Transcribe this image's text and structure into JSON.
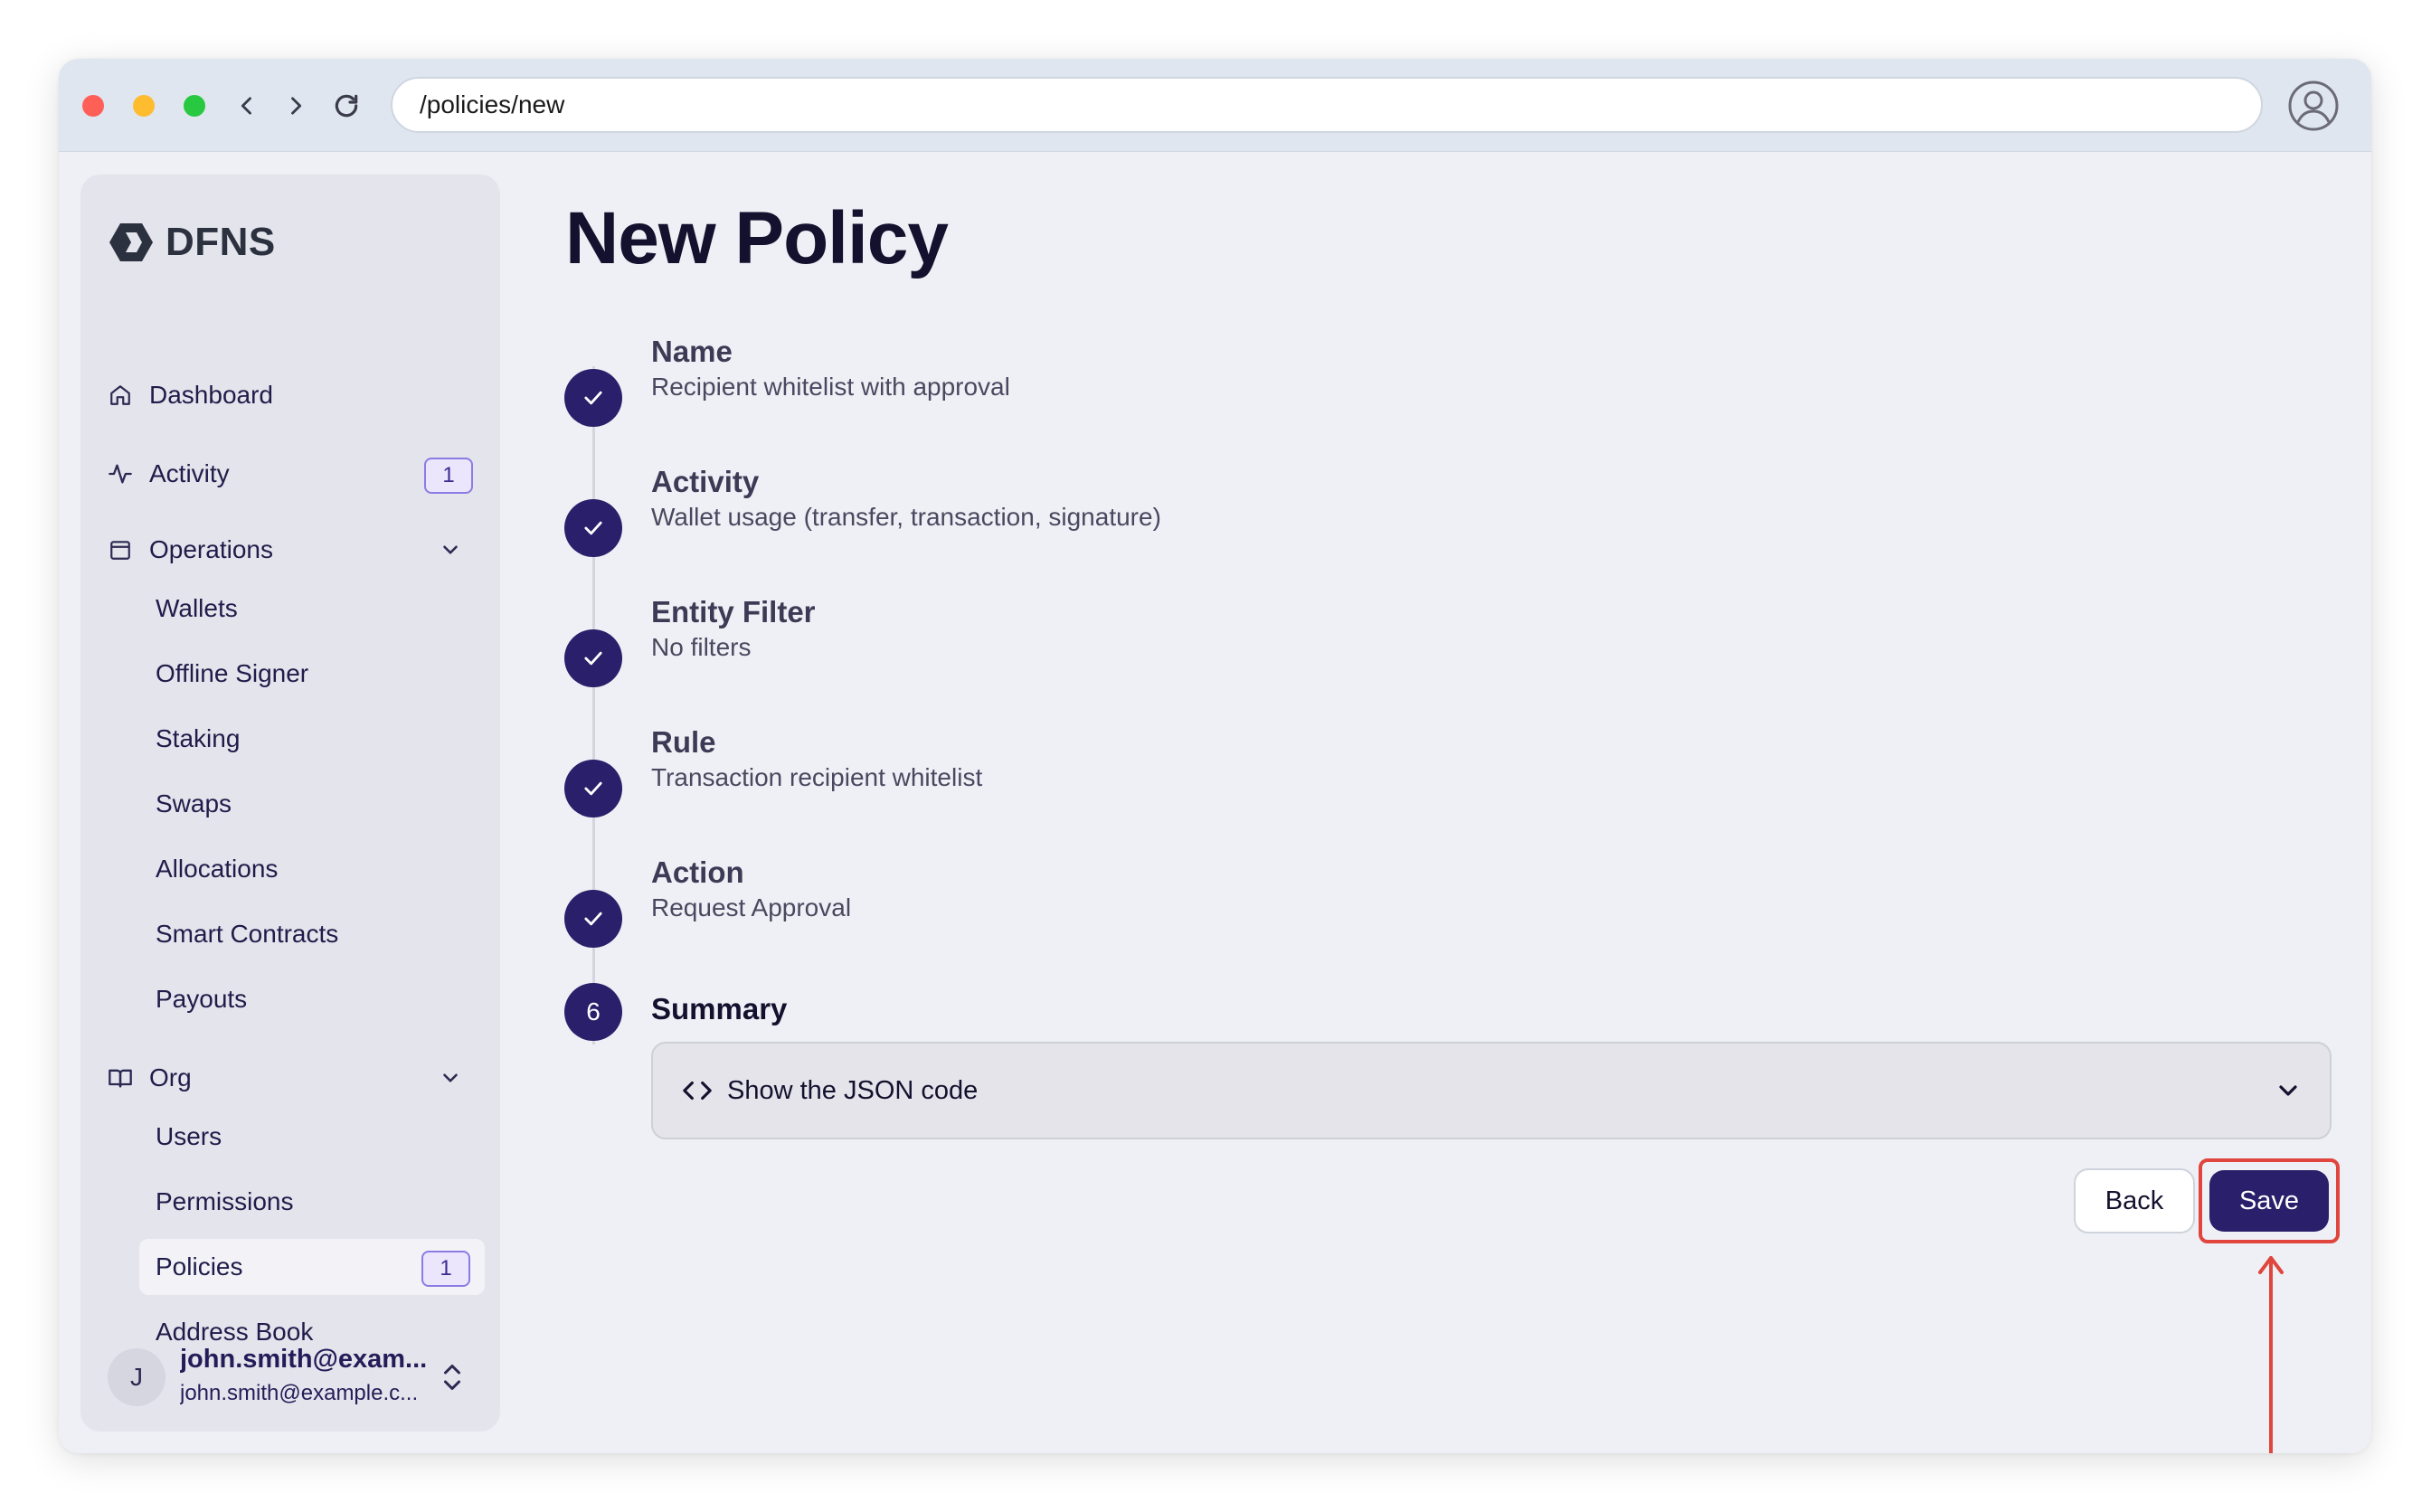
{
  "browser": {
    "url": "/policies/new"
  },
  "sidebar": {
    "logo_text": "DFNS",
    "items": [
      {
        "label": "Dashboard",
        "icon": "home-icon"
      },
      {
        "label": "Activity",
        "icon": "activity-icon",
        "badge": "1"
      },
      {
        "label": "Operations",
        "icon": "calendar-icon",
        "expanded": true
      },
      {
        "label": "Org",
        "icon": "book-icon",
        "expanded": true
      }
    ],
    "operations_items": [
      "Wallets",
      "Offline Signer",
      "Staking",
      "Swaps",
      "Allocations",
      "Smart Contracts",
      "Payouts"
    ],
    "org_items": [
      {
        "label": "Users"
      },
      {
        "label": "Permissions"
      },
      {
        "label": "Policies",
        "badge": "1",
        "active": true
      },
      {
        "label": "Address Book"
      }
    ],
    "user": {
      "initial": "J",
      "name": "john.smith@exam...",
      "email": "john.smith@example.c..."
    }
  },
  "main": {
    "title": "New Policy",
    "steps": [
      {
        "title": "Name",
        "value": "Recipient whitelist with approval",
        "status": "completed"
      },
      {
        "title": "Activity",
        "value": "Wallet usage (transfer, transaction, signature)",
        "status": "completed"
      },
      {
        "title": "Entity Filter",
        "value": "No filters",
        "status": "completed"
      },
      {
        "title": "Rule",
        "value": "Transaction recipient whitelist",
        "status": "completed"
      },
      {
        "title": "Action",
        "value": "Request Approval",
        "status": "completed"
      }
    ],
    "summary": {
      "number": "6",
      "title": "Summary",
      "json_toggle_label": "Show the JSON code"
    },
    "back_label": "Back",
    "save_label": "Save"
  },
  "colors": {
    "accent": "#2a1f6b",
    "badge_border": "#8b7be3",
    "highlight": "#e0453e"
  }
}
